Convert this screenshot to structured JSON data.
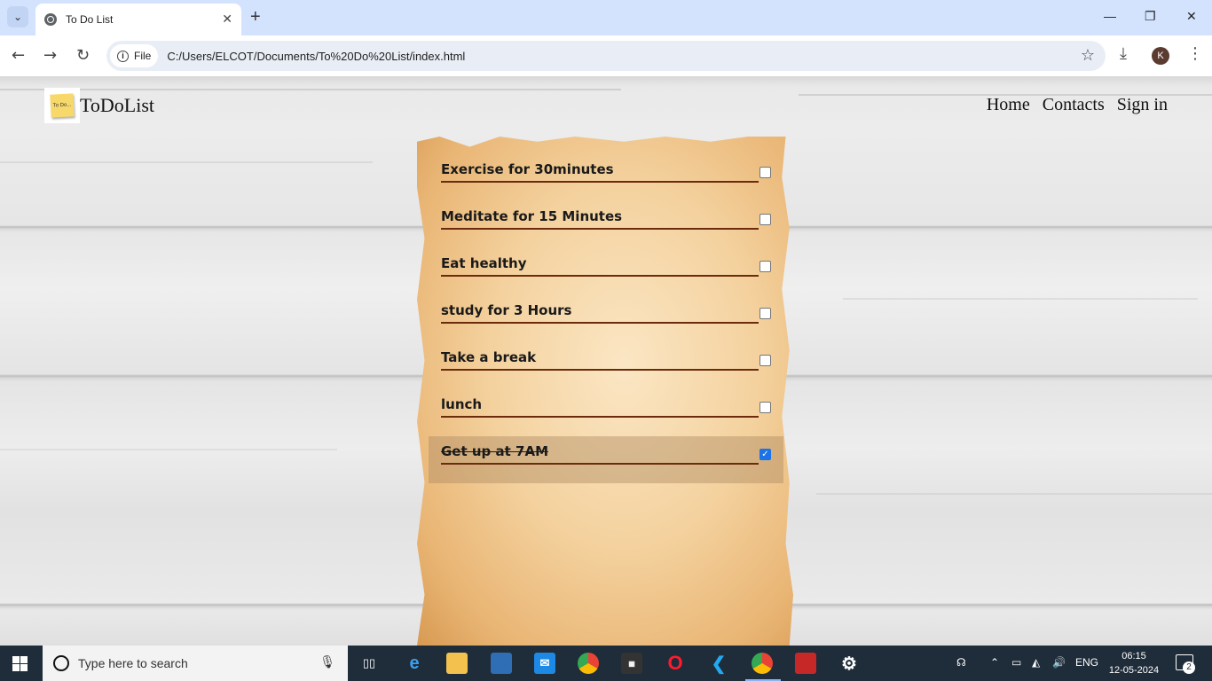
{
  "browser": {
    "tab_title": "To Do List",
    "new_tab_symbol": "+",
    "url_chip": "File",
    "url": "C:/Users/ELCOT/Documents/To%20Do%20List/index.html",
    "profile_initial": "K"
  },
  "site": {
    "logo_text": "To Do...",
    "brand": "ToDoList",
    "nav": [
      "Home",
      "Contacts",
      "Sign in"
    ]
  },
  "todos": [
    {
      "text": "Exercise for 30minutes",
      "checked": false
    },
    {
      "text": "Meditate for 15 Minutes",
      "checked": false
    },
    {
      "text": "Eat healthy",
      "checked": false
    },
    {
      "text": "study for 3 Hours",
      "checked": false
    },
    {
      "text": "Take a break",
      "checked": false
    },
    {
      "text": "lunch",
      "checked": false
    },
    {
      "text": "Get up at 7AM",
      "checked": true
    }
  ],
  "taskbar": {
    "search_placeholder": "Type here to search",
    "language": "ENG",
    "time": "06:15",
    "date": "12-05-2024",
    "notifications": "2"
  }
}
